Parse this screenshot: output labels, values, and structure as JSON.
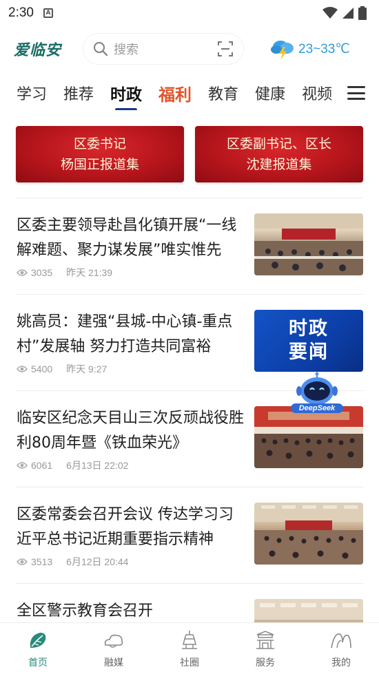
{
  "status_bar": {
    "time": "2:30",
    "notification_icon": "a-icon"
  },
  "header": {
    "logo": "爱临安",
    "search": {
      "placeholder": "搜索"
    },
    "weather": {
      "text": "23~33℃",
      "icon": "thunder-cloud-icon"
    }
  },
  "tabs": [
    {
      "label": "学习"
    },
    {
      "label": "推荐"
    },
    {
      "label": "时政",
      "active": true
    },
    {
      "label": "福利"
    },
    {
      "label": "教育"
    },
    {
      "label": "健康"
    },
    {
      "label": "视频"
    }
  ],
  "banners": [
    {
      "line1": "区委书记",
      "line2": "杨国正报道集"
    },
    {
      "line1": "区委副书记、区长",
      "line2": "沈建报道集"
    }
  ],
  "news": [
    {
      "title": "区委主要领导赴昌化镇开展“一线解难题、聚力谋发展”唯实惟先",
      "views": "3035",
      "time": "昨天 21:39"
    },
    {
      "title": "姚高员：建强“县城-中心镇-重点村”发展轴 努力打造共同富裕",
      "views": "5400",
      "time": "昨天 9:27",
      "thumb_text1": "时政",
      "thumb_text2": "要闻"
    },
    {
      "title": "临安区纪念天目山三次反顽战役胜利80周年暨《铁血荣光》",
      "views": "6061",
      "time": "6月13日 22:02"
    },
    {
      "title": "区委常委会召开会议 传达学习习近平总书记近期重要指示精神",
      "views": "3513",
      "time": "6月12日 20:44"
    },
    {
      "title": "全区警示教育会召开",
      "views": "",
      "time": ""
    }
  ],
  "robot_label": "DeepSeek",
  "bottom_nav": [
    {
      "label": "首页",
      "active": true
    },
    {
      "label": "融媒"
    },
    {
      "label": "社圈"
    },
    {
      "label": "服务"
    },
    {
      "label": "我的"
    }
  ],
  "colors": {
    "accent": "#153a8c",
    "fuli": "#e0542a",
    "brand": "#1a6d63",
    "weather": "#2d9bd8"
  }
}
